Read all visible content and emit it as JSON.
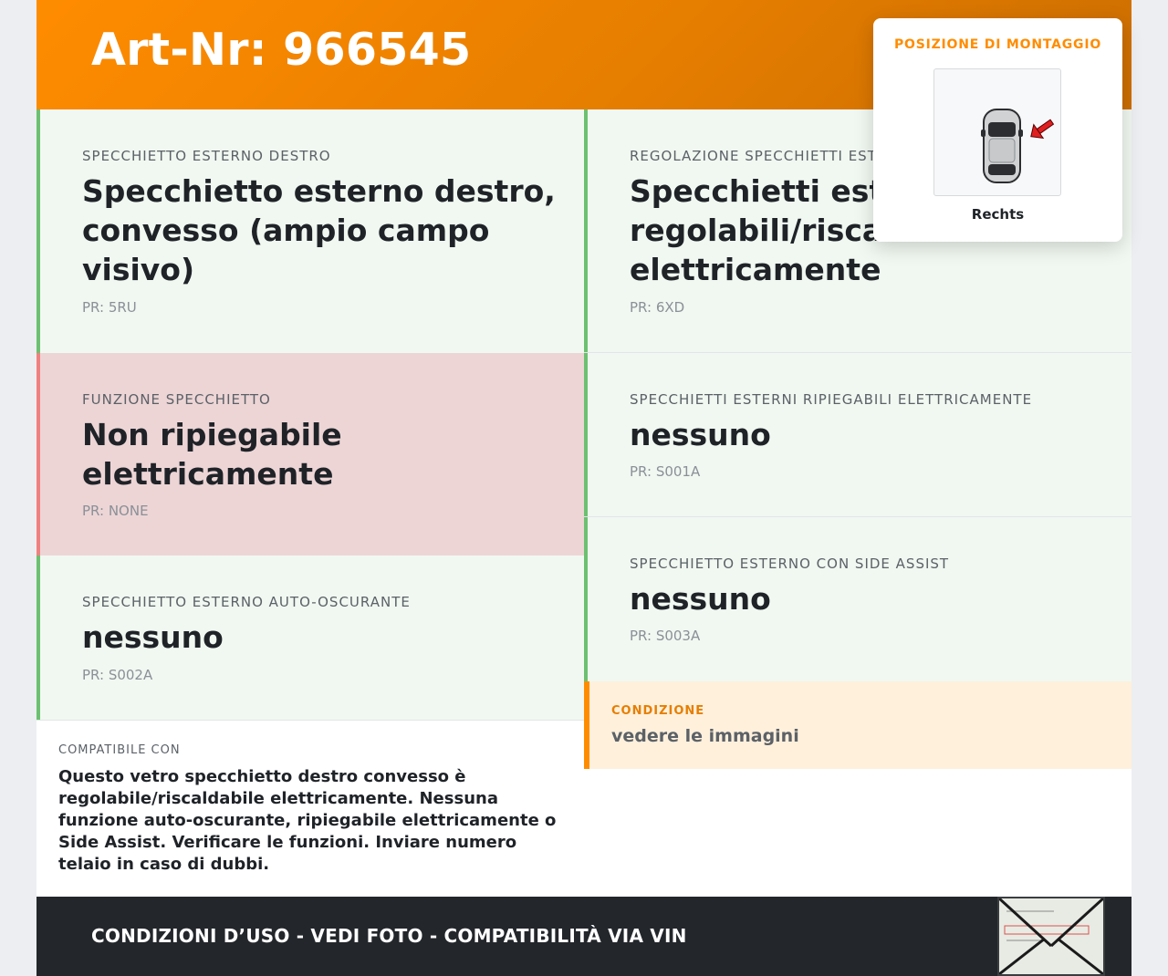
{
  "header": {
    "title": "Art-Nr: 966545"
  },
  "cards": {
    "mirror_right": {
      "label": "SPECCHIETTO ESTERNO DESTRO",
      "value": "Specchietto esterno destro, convesso (ampio campo visivo)",
      "pr": "PR: 5RU"
    },
    "mirror_adjust": {
      "label": "REGOLAZIONE SPECCHIETTI ESTERNI",
      "value": "Specchietti esterni regolabili/riscaldabili elettricamente",
      "pr": "PR: 6XD"
    },
    "mirror_function": {
      "label": "FUNZIONE SPECCHIETTO",
      "value": "Non ripiegabile elettricamente",
      "pr": "PR: NONE"
    },
    "mirror_folding": {
      "label": "SPECCHIETTI ESTERNI RIPIEGABILI ELETTRICAMENTE",
      "value": "nessuno",
      "pr": "PR: S001A"
    },
    "mirror_dimming": {
      "label": "SPECCHIETTO ESTERNO AUTO-OSCURANTE",
      "value": "nessuno",
      "pr": "PR: S002A"
    },
    "mirror_side_assist": {
      "label": "SPECCHIETTO ESTERNO CON SIDE ASSIST",
      "value": "nessuno",
      "pr": "PR: S003A"
    }
  },
  "condition": {
    "label": "CONDIZIONE",
    "value": "vedere le immagini"
  },
  "compat": {
    "label": "COMPATIBILE CON",
    "text": "Questo vetro specchietto destro convesso è regolabile/riscaldabile elettricamente. Nessuna funzione auto-oscurante, ripiegabile elettricamente o Side Assist. Verificare le funzioni. Inviare numero telaio in caso di dubbi."
  },
  "footer": {
    "text": "CONDIZIONI D’USO - VEDI FOTO - COMPATIBILITÀ VIA VIN"
  },
  "popup": {
    "title": "POSIZIONE DI MONTAGGIO",
    "position_label": "Rechts",
    "icon": "car-right-mirror-icon"
  },
  "colors": {
    "accent": "#ff8c00",
    "ok": "#6cc070",
    "warn": "#f08080",
    "footer": "#23262b"
  }
}
